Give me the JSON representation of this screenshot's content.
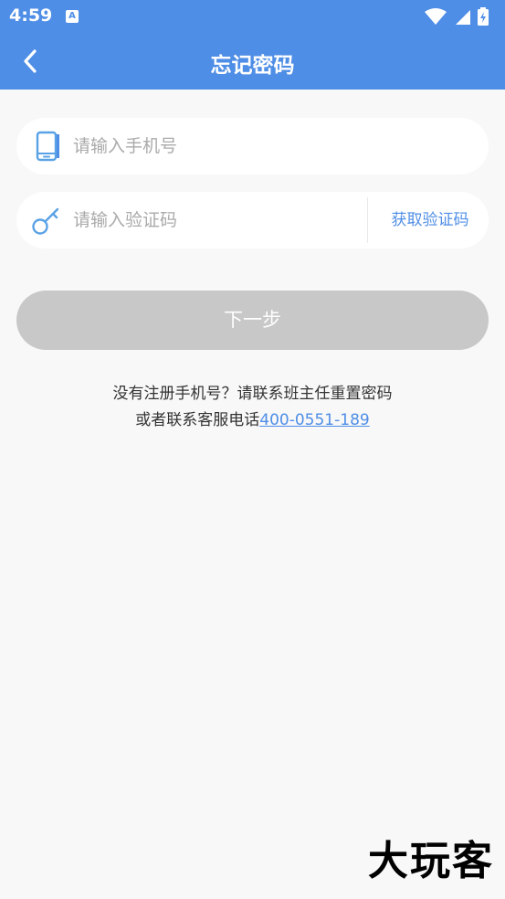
{
  "status_bar": {
    "time": "4:59",
    "indicator": "A",
    "icons": [
      "wifi-icon",
      "signal-icon",
      "battery-charging-icon"
    ]
  },
  "app_bar": {
    "back_icon": "chevron-left-icon",
    "title": "忘记密码"
  },
  "form": {
    "phone": {
      "icon": "phone-icon",
      "placeholder": "请输入手机号",
      "value": ""
    },
    "code": {
      "icon": "key-icon",
      "placeholder": "请输入验证码",
      "value": "",
      "get_code_label": "获取验证码"
    },
    "next_label": "下一步"
  },
  "help": {
    "line1": "没有注册手机号？请联系班主任重置密码",
    "line2_prefix": "或者联系客服电话",
    "phone": "400-0551-189"
  },
  "watermark": "大玩客",
  "colors": {
    "primary": "#4f8ee6",
    "disabled_button": "#c8c8c8",
    "background": "#f8f8f8"
  }
}
